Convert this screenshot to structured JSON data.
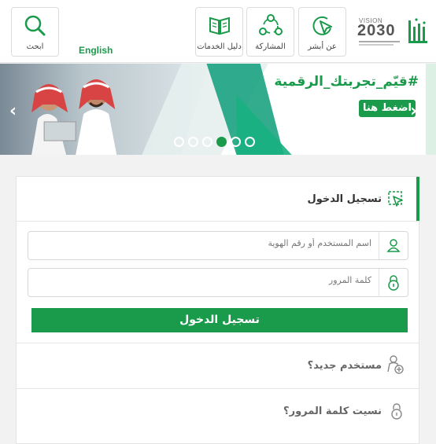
{
  "header": {
    "search_label": "ابحث",
    "english_label": "English",
    "services_label": "دليل الخدمات",
    "participation_label": "المشاركة",
    "about_label": "عن أبشر",
    "vision_title": "VISION",
    "vision_year": "2030"
  },
  "banner": {
    "headline": "#قيّم_تجربتك_الرقمية",
    "cta_label": "اضغط هنا",
    "slide_count": 6,
    "active_slide": 3
  },
  "login": {
    "title": "تسجيل الدخول",
    "username_placeholder": "اسم المستخدم أو رقم الهوية",
    "password_placeholder": "كلمة المرور",
    "submit_label": "تسجيل الدخول",
    "new_user_label": "مستخدم جديد؟",
    "forgot_password_label": "نسيت كلمة المرور؟"
  },
  "colors": {
    "brand_green": "#1a9a4b",
    "banner_teal": "#0f9e7a"
  },
  "icons": {
    "search": "search-icon",
    "services": "book-icon",
    "participation": "share-nodes-icon",
    "about": "pointer-icon",
    "login": "login-icon",
    "user": "user-icon",
    "lock": "lock-icon",
    "new_user": "add-user-icon",
    "forgot": "key-lock-icon"
  }
}
